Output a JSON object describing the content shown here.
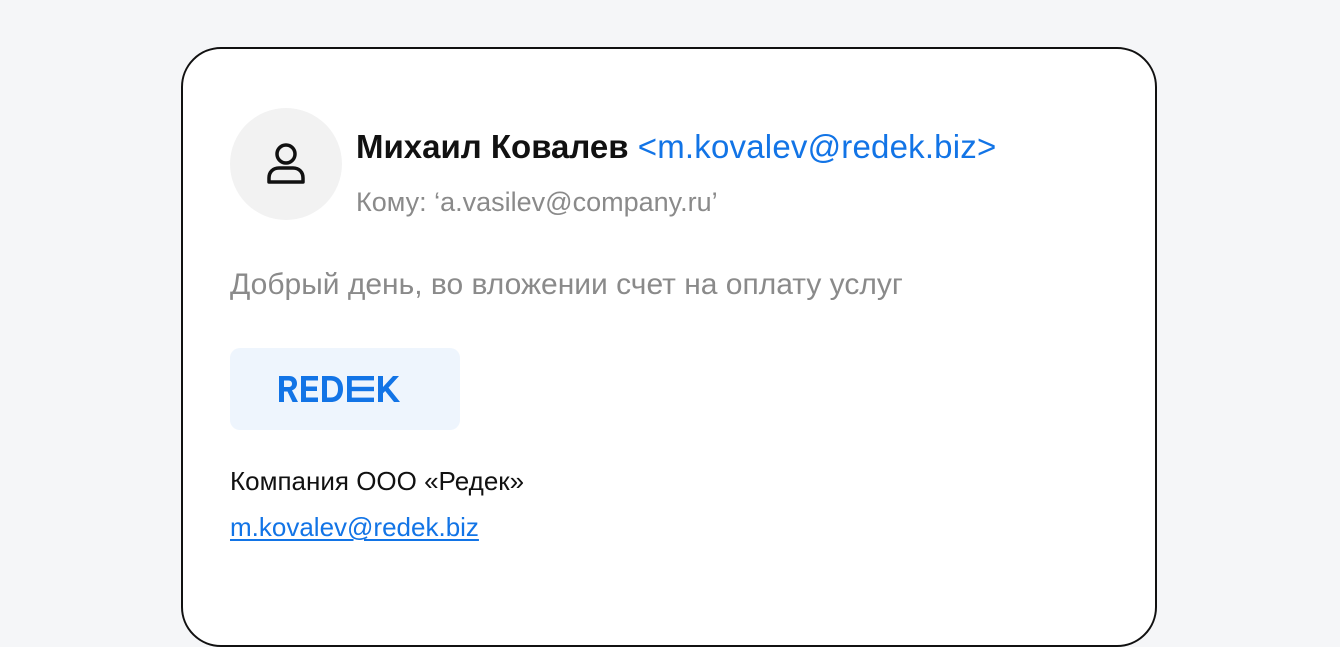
{
  "email": {
    "sender": {
      "name": "Михаил Ковалев",
      "email_display": "<m.kovalev@redek.biz>"
    },
    "recipient_line": "Кому: ‘a.vasilev@company.ru’",
    "body_text": "Добрый день, во вложении счет на оплату услуг",
    "signature": {
      "logo_text": "REDEK",
      "company": "Компания ООО «Редек»",
      "email": "m.kovalev@redek.biz"
    }
  },
  "icons": {
    "avatar": "user-icon"
  },
  "colors": {
    "accent": "#1274e6",
    "muted_text": "#8a8a8a",
    "logo_background": "#eef5fd",
    "avatar_background": "#f2f2f2",
    "page_background": "#f5f6f8"
  }
}
